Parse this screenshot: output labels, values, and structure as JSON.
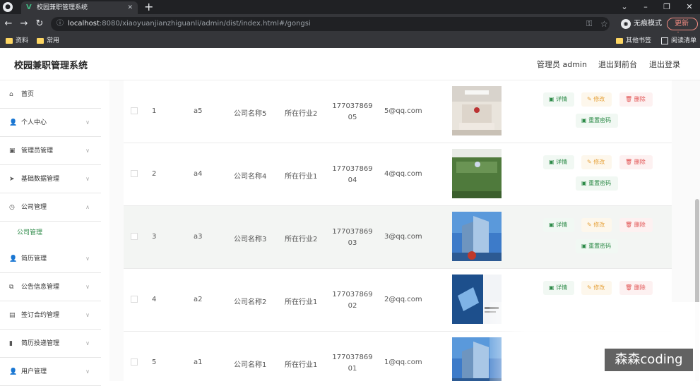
{
  "browser": {
    "tab_title": "校园兼职管理系统",
    "url_host": "localhost",
    "url_rest": ":8080/xiaoyuanjianzhiguanli/admin/dist/index.html#/gongsi",
    "incognito_label": "无痕模式",
    "update_label": "更新",
    "bookmarks": [
      "资料",
      "常用"
    ],
    "other_bookmarks": "其他书签",
    "reading_list": "阅读清单"
  },
  "header": {
    "title": "校园兼职管理系统",
    "user_label": "管理员 admin",
    "front_link": "退出到前台",
    "logout_link": "退出登录"
  },
  "sidebar": {
    "items": [
      {
        "label": "首页",
        "icon": "home-icon"
      },
      {
        "label": "个人中心",
        "icon": "user-icon"
      },
      {
        "label": "管理员管理",
        "icon": "admin-icon"
      },
      {
        "label": "基础数据管理",
        "icon": "send-icon"
      },
      {
        "label": "公司管理",
        "icon": "clock-icon"
      },
      {
        "label": "简历管理",
        "icon": "user-icon"
      },
      {
        "label": "公告信息管理",
        "icon": "copy-icon"
      },
      {
        "label": "签订合约管理",
        "icon": "contract-icon"
      },
      {
        "label": "简历投递管理",
        "icon": "bar-chart-icon"
      },
      {
        "label": "用户管理",
        "icon": "user-icon"
      }
    ],
    "active_sub": "公司管理"
  },
  "actions": {
    "detail": "详情",
    "edit": "修改",
    "delete": "删除",
    "reset": "重置密码"
  },
  "rows": [
    {
      "index": "1",
      "account": "a5",
      "name": "公司名称5",
      "industry": "所在行业2",
      "phone": "17703786905",
      "email": "5@qq.com",
      "image": "lobby"
    },
    {
      "index": "2",
      "account": "a4",
      "name": "公司名称4",
      "industry": "所在行业1",
      "phone": "17703786904",
      "email": "4@qq.com",
      "image": "green-wall"
    },
    {
      "index": "3",
      "account": "a3",
      "name": "公司名称3",
      "industry": "所在行业2",
      "phone": "17703786903",
      "email": "3@qq.com",
      "image": "tower"
    },
    {
      "index": "4",
      "account": "a2",
      "name": "公司名称2",
      "industry": "所在行业1",
      "phone": "17703786902",
      "email": "2@qq.com",
      "image": "brochure"
    },
    {
      "index": "5",
      "account": "a1",
      "name": "公司名称1",
      "industry": "所在行业1",
      "phone": "17703786901",
      "email": "1@qq.com",
      "image": "tower"
    }
  ],
  "watermark": "森森coding",
  "colors": {
    "accent": "#2c8a47",
    "edit": "#e6a23c",
    "delete": "#e15151"
  }
}
